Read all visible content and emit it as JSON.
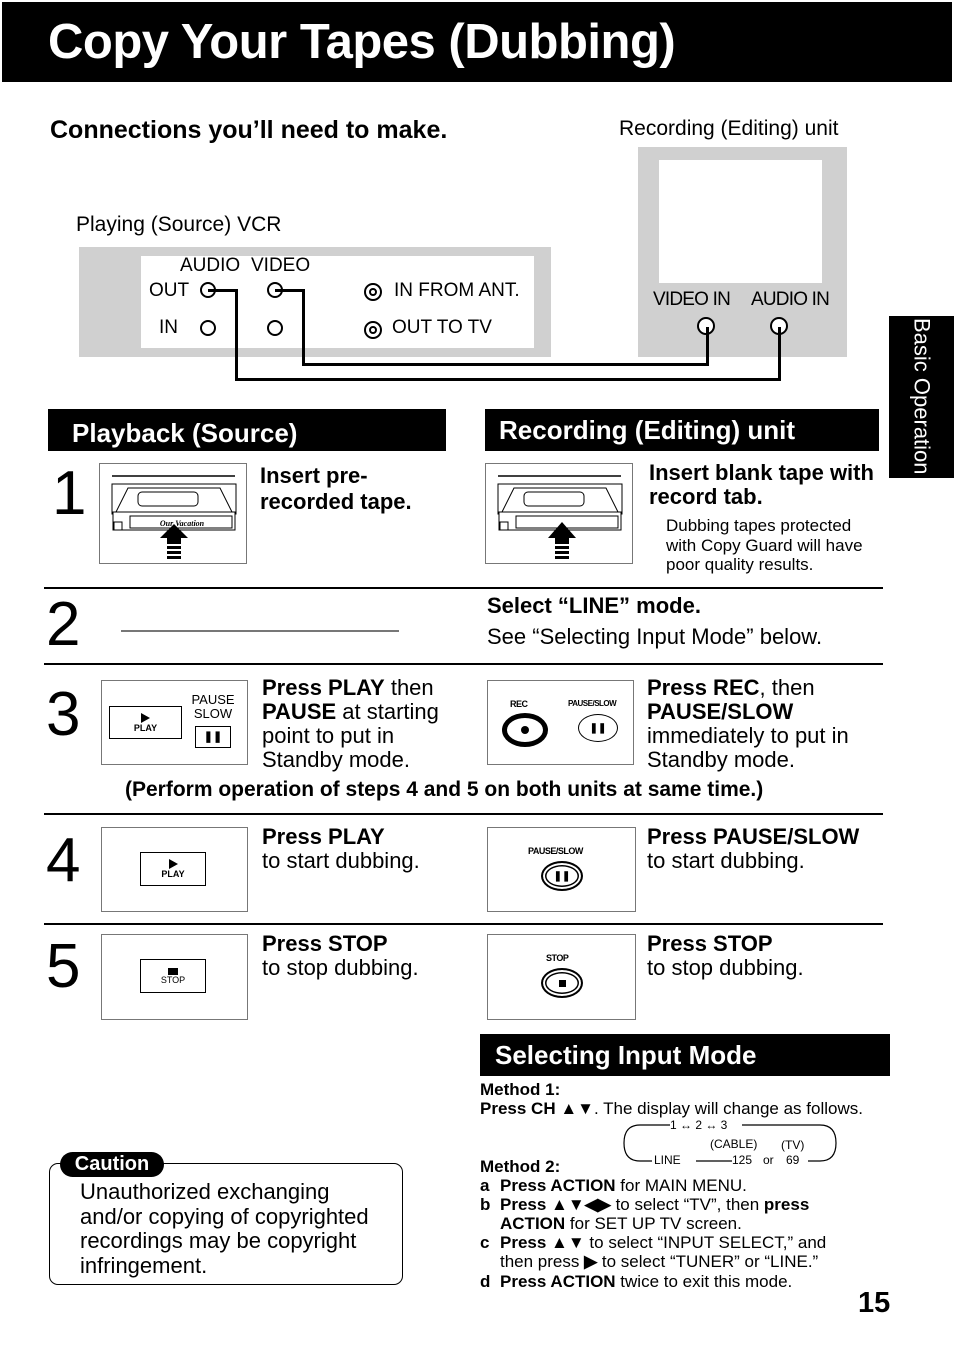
{
  "page": {
    "title": "Copy Your Tapes (Dubbing)",
    "page_number": "15",
    "side_tab": "Basic Operation"
  },
  "connections": {
    "heading": "Connections you’ll need to make.",
    "playing_label": "Playing (Source) VCR",
    "recording_label": "Recording (Editing) unit",
    "vcr": {
      "audio": "AUDIO",
      "video": "VIDEO",
      "out": "OUT",
      "in": "IN",
      "in_from_ant": "IN FROM ANT.",
      "out_to_tv": "OUT TO TV"
    },
    "tv": {
      "video_in": "VIDEO IN",
      "audio_in": "AUDIO IN"
    }
  },
  "sections": {
    "playback": "Playback (Source)",
    "recording": "Recording (Editing) unit"
  },
  "steps": [
    {
      "num": "1",
      "left": {
        "bold": "Insert pre-\nrecorded tape.",
        "tape_label": "Our Vacation"
      },
      "right": {
        "bold": "Insert blank tape with record tab.",
        "note": [
          "Dubbing tapes protected",
          "with Copy Guard will have",
          "poor quality results."
        ]
      }
    },
    {
      "num": "2",
      "right": {
        "bold": "Select “LINE” mode.",
        "text": "See “Selecting Input Mode” below."
      }
    },
    {
      "num": "3",
      "left": {
        "b1": "Press PLAY",
        "t1": " then",
        "b2": "PAUSE",
        "t2": " at starting",
        "t3": "point to put in",
        "t4": "Standby mode.",
        "btn_play": "PLAY",
        "btn_pause_top": "PAUSE",
        "btn_pause_bottom": "SLOW"
      },
      "right": {
        "b1": "Press REC",
        "t1": ", then",
        "b2": "PAUSE/SLOW",
        "t3": "immediately to put in",
        "t4": "Standby mode.",
        "btn_rec": "REC",
        "btn_pause": "PAUSE/SLOW"
      },
      "note": "(Perform operation of steps 4 and 5 on both units at same time.)"
    },
    {
      "num": "4",
      "left": {
        "bold": "Press PLAY",
        "text": "to start dubbing.",
        "btn": "PLAY"
      },
      "right": {
        "bold": "Press PAUSE/SLOW",
        "text": "to start dubbing.",
        "btn": "PAUSE/SLOW"
      }
    },
    {
      "num": "5",
      "left": {
        "bold": "Press STOP",
        "text": "to stop dubbing.",
        "btn": "STOP"
      },
      "right": {
        "bold": "Press STOP",
        "text": "to stop dubbing.",
        "btn": "STOP"
      }
    }
  ],
  "caution": {
    "label": "Caution",
    "lines": [
      "Unauthorized exchanging",
      "and/or copying of copyrighted",
      "recordings may be copyright",
      "infringement."
    ]
  },
  "input_mode": {
    "heading": "Selecting Input Mode",
    "method1_label": "Method 1:",
    "method1_bold": "Press CH ▲▼",
    "method1_text": ". The display will change as follows.",
    "cycle": {
      "top": "1 ↔ 2 ↔ 3",
      "line": "LINE",
      "cable_label": "(CABLE)",
      "tv_label": "(TV)",
      "v125": "125",
      "or": "or",
      "v69": "69"
    },
    "method2_label": "Method 2:",
    "items": [
      {
        "letter": "a",
        "bold": "Press ACTION",
        "text": " for MAIN MENU."
      },
      {
        "letter": "b",
        "bold": "Press ▲▼◀▶",
        "text": " to select “TV”, then ",
        "bold2": "press",
        "line2_bold": "ACTION",
        "line2_text": " for SET UP TV screen."
      },
      {
        "letter": "c",
        "bold": "Press ▲▼",
        "text": " to select “INPUT SELECT,” and",
        "line2_text": "then press ",
        "line2_bold": "▶",
        "line2_text2": " to select “TUNER” or “LINE.”"
      },
      {
        "letter": "d",
        "bold": "Press ACTION",
        "text": " twice to exit this mode."
      }
    ]
  }
}
